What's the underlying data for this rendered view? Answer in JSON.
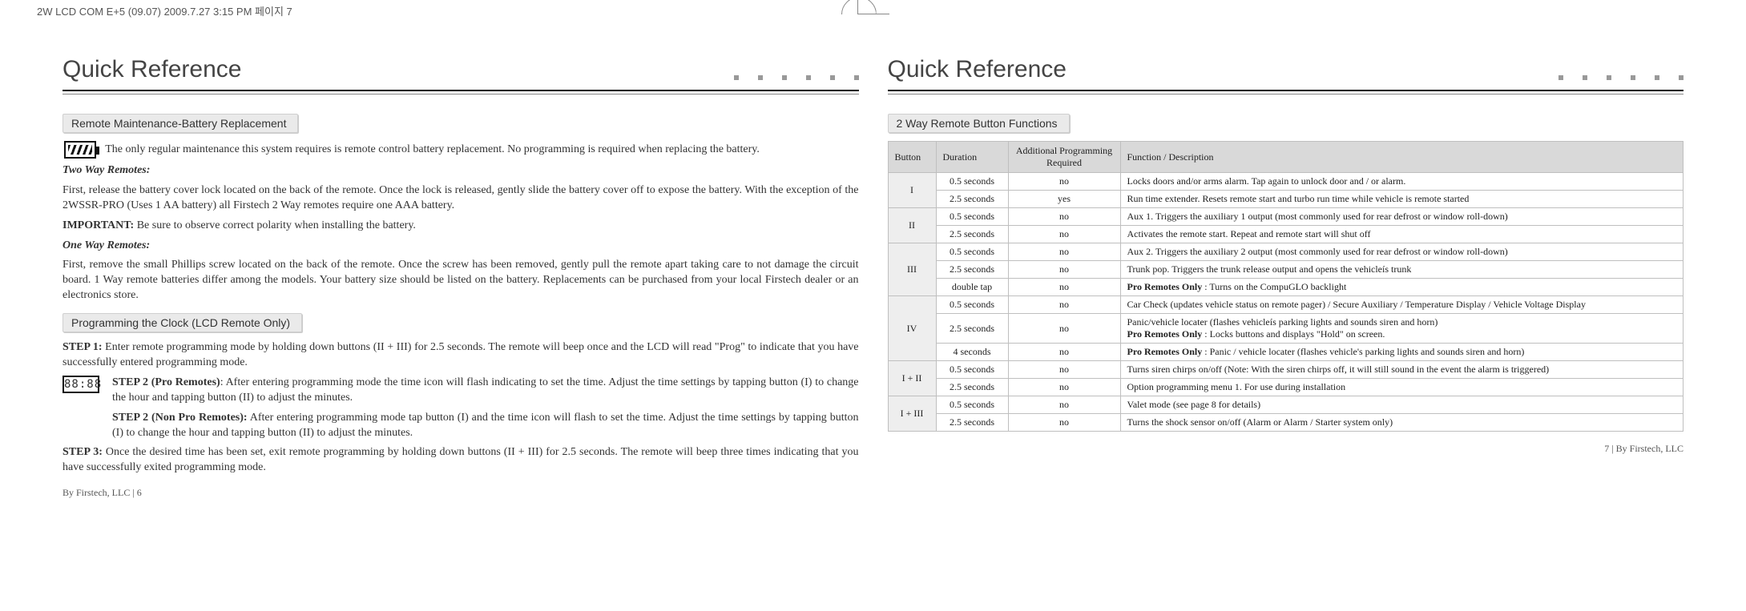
{
  "jobline": "2W LCD COM E+5 (09.07)  2009.7.27 3:15 PM  페이지 7",
  "left": {
    "title": "Quick Reference",
    "sec1": {
      "heading": "Remote Maintenance-Battery Replacement",
      "intro": "The only regular maintenance this system requires is remote control battery replacement. No programming is required when replacing the battery.",
      "two_h": "Two Way Remotes:",
      "two_p1": "First, release the battery cover lock located on the back of the remote. Once the lock is released, gently slide the battery cover off to expose the battery. With the exception of the 2WSSR-PRO (Uses 1 AA battery) all Firstech 2 Way remotes require one AAA battery.",
      "two_imp_l": "IMPORTANT:",
      "two_imp_t": "  Be sure to observe correct polarity when installing the battery.",
      "one_h": "One Way Remotes:",
      "one_p": "First, remove the small Phillips screw located on the back of the remote. Once the screw has been removed, gently pull the remote apart taking care to not damage the circuit board. 1 Way remote batteries differ among the models. Your battery size should be listed on the battery. Replacements can be purchased from your local Firstech dealer or an electronics store."
    },
    "sec2": {
      "heading": "Programming the Clock (LCD Remote Only)",
      "s1_l": "STEP 1:",
      "s1_t": " Enter remote programming mode by holding down buttons (II + III) for 2.5 seconds. The remote will beep once and the LCD will read \"Prog\" to indicate that you have successfully entered programming mode.",
      "s2a_l": "STEP 2 (Pro Remotes)",
      "s2a_t": ": After entering programming mode the time icon will flash indicating to set the time. Adjust the time settings by tapping button (I) to change the hour and tapping button (II) to adjust the minutes.",
      "s2b_l": "STEP 2 (Non Pro Remotes):",
      "s2b_t": " After entering programming mode tap button (I) and the time icon will flash to set the time. Adjust the time settings by tapping button (I) to change the hour and tapping button (II) to adjust the minutes.",
      "s3_l": "STEP 3:",
      "s3_t": " Once the desired time has been set, exit remote programming by holding down buttons (II + III) for 2.5 seconds.  The remote will beep three times indicating that you have successfully exited programming mode.",
      "clock_txt": "88:88"
    },
    "footer": "By Firstech, LLC   |    6"
  },
  "right": {
    "title": "Quick Reference",
    "sec": {
      "heading": "2 Way Remote Button Functions"
    },
    "th": {
      "button": "Button",
      "duration": "Duration",
      "prog": "Additional Programming Required",
      "func": "Function / Description"
    },
    "footer": "7   |   By Firstech, LLC"
  },
  "chart_data": {
    "type": "table",
    "title": "2 Way Remote Button Functions",
    "columns": [
      "Button",
      "Duration",
      "Additional Programming Required",
      "Function / Description"
    ],
    "rows": [
      {
        "b": "I",
        "d": "0.5 seconds",
        "p": "no",
        "f": "Locks doors and/or arms alarm. Tap again to unlock door and / or alarm."
      },
      {
        "b": "I",
        "d": "2.5 seconds",
        "p": "yes",
        "f": "Run time extender. Resets remote start and turbo run time while vehicle is remote started"
      },
      {
        "b": "II",
        "d": "0.5 seconds",
        "p": "no",
        "f": "Aux 1. Triggers the auxiliary 1 output (most commonly used for rear defrost or window roll-down)"
      },
      {
        "b": "II",
        "d": "2.5 seconds",
        "p": "no",
        "f": "Activates the remote start. Repeat and remote start will shut off"
      },
      {
        "b": "III",
        "d": "0.5 seconds",
        "p": "no",
        "f": "Aux 2. Triggers the auxiliary 2 output (most commonly used for rear defrost or window roll-down)"
      },
      {
        "b": "III",
        "d": "2.5 seconds",
        "p": "no",
        "f": "Trunk pop. Triggers the trunk release output and opens the vehicleís trunk"
      },
      {
        "b": "III",
        "d": "double tap",
        "p": "no",
        "f": "<b>Pro Remotes Only</b> : Turns on the CompuGLO backlight"
      },
      {
        "b": "IV",
        "d": "0.5 seconds",
        "p": "no",
        "f": "Car Check (updates vehicle status on remote pager) / Secure Auxiliary / Temperature Display / Vehicle Voltage Display"
      },
      {
        "b": "IV",
        "d": "2.5 seconds",
        "p": "no",
        "f": "Panic/vehicle locater (flashes vehicleís parking lights and sounds siren and horn)<br><b>Pro Remotes Only</b> : Locks buttons and displays \"Hold\" on screen."
      },
      {
        "b": "IV",
        "d": "4 seconds",
        "p": "no",
        "f": "<b>Pro Remotes Only</b> : Panic / vehicle locater (flashes vehicle's parking lights and sounds siren and horn)"
      },
      {
        "b": "I + II",
        "d": "0.5 seconds",
        "p": "no",
        "f": "Turns siren chirps on/off (Note: With the siren chirps off, it will still sound in the event the alarm is triggered)"
      },
      {
        "b": "I + II",
        "d": "2.5 seconds",
        "p": "no",
        "f": "Option programming menu 1. For use during installation"
      },
      {
        "b": "I + III",
        "d": "0.5 seconds",
        "p": "no",
        "f": "Valet mode (see page 8 for details)"
      },
      {
        "b": "I + III",
        "d": "2.5 seconds",
        "p": "no",
        "f": "Turns the shock sensor on/off (Alarm or Alarm / Starter system only)"
      }
    ],
    "button_rowspans": {
      "I": 2,
      "II": 2,
      "III": 3,
      "IV": 3,
      "I + II": 2,
      "I + III": 2
    }
  }
}
